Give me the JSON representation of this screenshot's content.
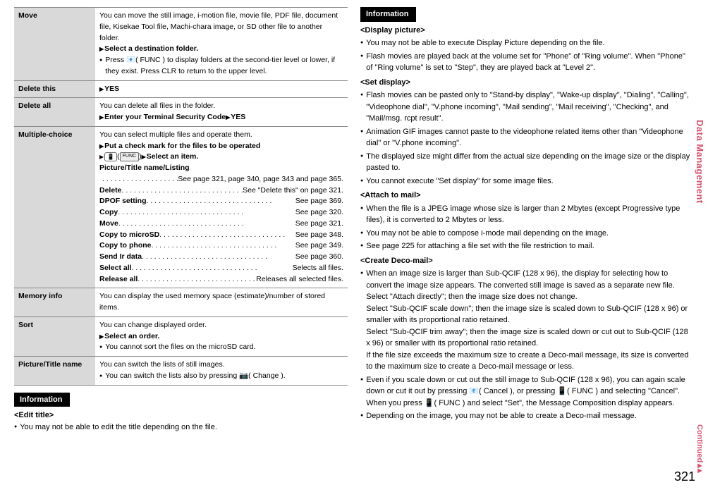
{
  "sidetab": "Data Management",
  "continued": "Continued",
  "pagenum": "321",
  "left": {
    "rows": [
      {
        "label": "Move",
        "body": "You can move the still image, i-motion file, movie file, PDF file, document file, Kisekae Tool file, Machi-chara image, or SD other file to another folder.",
        "action": "Select a destination folder.",
        "note": "Press 📧( FUNC ) to display folders at the second-tier level or lower, if they exist. Press CLR to return to the upper level."
      },
      {
        "label": "Delete this",
        "yes": "YES"
      },
      {
        "label": "Delete all",
        "body": "You can delete all files in the folder.",
        "action2a": "Enter your Terminal Security Code",
        "action2b": "YES"
      },
      {
        "label": "Multiple-choice",
        "body": "You can select multiple files and operate them.",
        "actionA": "Put a check mark for the files to be operated",
        "actionB": "Select an item.",
        "subtitle": "Picture/Title name/Listing",
        "items": [
          {
            "k": "",
            "v": "See page 321, page 340, page 343 and page 365."
          },
          {
            "k": "Delete",
            "v": "See \"Delete this\" on page 321."
          },
          {
            "k": "DPOF setting",
            "v": "See page 369."
          },
          {
            "k": "Copy",
            "v": "See page 320."
          },
          {
            "k": "Move",
            "v": "See page 321."
          },
          {
            "k": "Copy to microSD",
            "v": "See page 348."
          },
          {
            "k": "Copy to phone",
            "v": "See page 349."
          },
          {
            "k": "Send Ir data",
            "v": "See page 360."
          },
          {
            "k": "Select all",
            "v": "Selects all files."
          },
          {
            "k": "Release all",
            "v": "Releases all selected files."
          }
        ]
      },
      {
        "label": "Memory info",
        "body": "You can display the used memory space (estimate)/number of stored items."
      },
      {
        "label": "Sort",
        "body": "You can change displayed order.",
        "action": "Select an order.",
        "note2": "You cannot sort the files on the microSD card."
      },
      {
        "label": "Picture/Title name",
        "body": "You can switch the lists of still images.",
        "note2": "You can switch the lists also by pressing 📷( Change )."
      }
    ],
    "info_hdr": "Information",
    "edit_title": "<Edit title>",
    "edit_note": "You may not be able to edit the title depending on the file."
  },
  "right": {
    "info_hdr": "Information",
    "sections": [
      {
        "title": "<Display picture>",
        "items": [
          "You may not be able to execute Display Picture depending on the file.",
          "Flash movies are played back at the volume set for \"Phone\" of \"Ring volume\". When \"Phone\" of \"Ring volume\" is set to \"Step\", they are played back at \"Level 2\"."
        ]
      },
      {
        "title": "<Set display>",
        "items": [
          "Flash movies can be pasted only to \"Stand-by display\", \"Wake-up display\", \"Dialing\", \"Calling\", \"Videophone dial\", \"V.phone incoming\", \"Mail sending\", \"Mail receiving\", \"Checking\", and \"Mail/msg. rcpt result\".",
          "Animation GIF images cannot paste to the videophone related items other than \"Videophone dial\" or \"V.phone incoming\".",
          "The displayed size might differ from the actual size depending on the image size or the display pasted to.",
          "You cannot execute \"Set display\" for some image files."
        ]
      },
      {
        "title": "<Attach to mail>",
        "items": [
          "When the file is a JPEG image whose size is larger than 2 Mbytes (except Progressive type files), it is converted to 2 Mbytes or less.",
          "You may not be able to compose i-mode mail depending on the image.",
          "See page 225 for attaching a file set with the file restriction to mail."
        ]
      },
      {
        "title": "<Create Deco-mail>",
        "items": [
          "When an image size is larger than Sub-QCIF (128 x 96), the display for selecting how to convert the image size appears. The converted still image is saved as a separate new file.\nSelect \"Attach directly\"; then the image size does not change.\nSelect \"Sub-QCIF scale down\"; then the image size is scaled down to Sub-QCIF (128 x 96) or smaller with its proportional ratio retained.\nSelect \"Sub-QCIF trim away\"; then the image size is scaled down or cut out to Sub-QCIF (128 x 96) or smaller with its proportional ratio retained.\nIf the file size exceeds the maximum size to create a Deco-mail message, its size is converted to the maximum size to create a Deco-mail message or less.",
          "Even if you scale down or cut out the still image to Sub-QCIF (128 x 96), you can again scale down or cut it out by pressing 📧( Cancel ), or pressing 📱( FUNC ) and selecting \"Cancel\". When you press 📱( FUNC ) and select \"Set\", the Message Composition display appears.",
          "Depending on the image, you may not be able to create a Deco-mail message."
        ]
      }
    ]
  }
}
